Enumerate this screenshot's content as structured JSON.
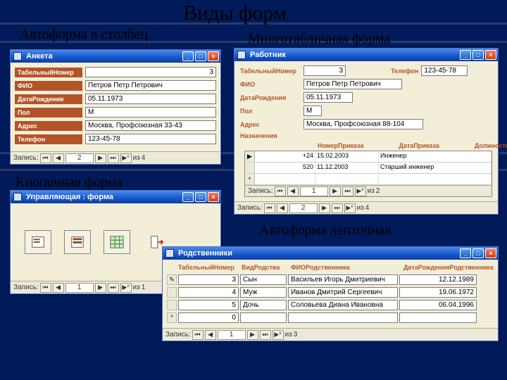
{
  "title": "Виды форм",
  "labels": {
    "columnar": "Автоформа в столбец",
    "multi": "Многотабличная форма",
    "button": "Кнопочная форма",
    "tape": "Автоформа ленточная"
  },
  "nav": {
    "prefix": "Запись:",
    "of": "из"
  },
  "win_btns": {
    "min": "_",
    "max": "□",
    "close": "×"
  },
  "columnar": {
    "title": "Анкета",
    "fields": {
      "tab_no_lbl": "ТабельныйНомер",
      "tab_no_val": "3",
      "fio_lbl": "ФИО",
      "fio_val": "Петров Петр Петрович",
      "dob_lbl": "ДатаРождения",
      "dob_val": "05.11.1973",
      "sex_lbl": "Пол",
      "sex_val": "М",
      "addr_lbl": "Адрес",
      "addr_val": "Москва, Профсоюзная 33-43",
      "tel_lbl": "Телефон",
      "tel_val": "123-45-78"
    },
    "nav_pos": "2",
    "nav_total": "4"
  },
  "button_form": {
    "title": "Управляющая : форма",
    "nav_pos": "1",
    "nav_total": "1"
  },
  "multi": {
    "title": "Работник",
    "fields": {
      "tab_no_lbl": "ТабельныйНомер",
      "tab_no_val": "3",
      "tel_lbl": "Телефон",
      "tel_val": "123-45-78",
      "fio_lbl": "ФИО",
      "fio_val": "Петров Петр Петрович",
      "dob_lbl": "ДатаРождения",
      "dob_val": "05.11.1973",
      "sex_lbl": "Пол",
      "sex_val": "М",
      "addr_lbl": "Адрес",
      "addr_val": "Москва, Профсоюзная 88-104",
      "assign_lbl": "Назначения"
    },
    "sub_headers": {
      "num": "НомерПриказа",
      "date": "ДатаПриказа",
      "pos": "Должность"
    },
    "sub_rows": [
      {
        "sel": "▶",
        "num": "+24",
        "date": "15.02.2003",
        "pos": "Инженер"
      },
      {
        "sel": "",
        "num": "520",
        "date": "11.12.2003",
        "pos": "Старший инженер"
      },
      {
        "sel": "*",
        "num": "",
        "date": "",
        "pos": ""
      }
    ],
    "sub_nav_pos": "1",
    "sub_nav_total": "2",
    "nav_pos": "2",
    "nav_total": "4"
  },
  "tape": {
    "title": "Родственники",
    "headers": {
      "tab": "ТабельныйНомер",
      "rel": "ВидРодства",
      "fio": "ФИОРодственника",
      "dob": "ДатаРожденияРодственника"
    },
    "rows": [
      {
        "sel": "✎",
        "tab": "3",
        "rel": "Сын",
        "fio": "Васильев Игорь Дмитриевич",
        "dob": "12.12.1989"
      },
      {
        "sel": "",
        "tab": "4",
        "rel": "Муж",
        "fio": "Иванов Дмитрий Сергеевич",
        "dob": "19.06.1972"
      },
      {
        "sel": "",
        "tab": "5",
        "rel": "Дочь",
        "fio": "Соловьева Диана Ивановна",
        "dob": "06.04.1996"
      },
      {
        "sel": "*",
        "tab": "0",
        "rel": "",
        "fio": "",
        "dob": ""
      }
    ],
    "nav_pos": "1",
    "nav_total": "3"
  }
}
